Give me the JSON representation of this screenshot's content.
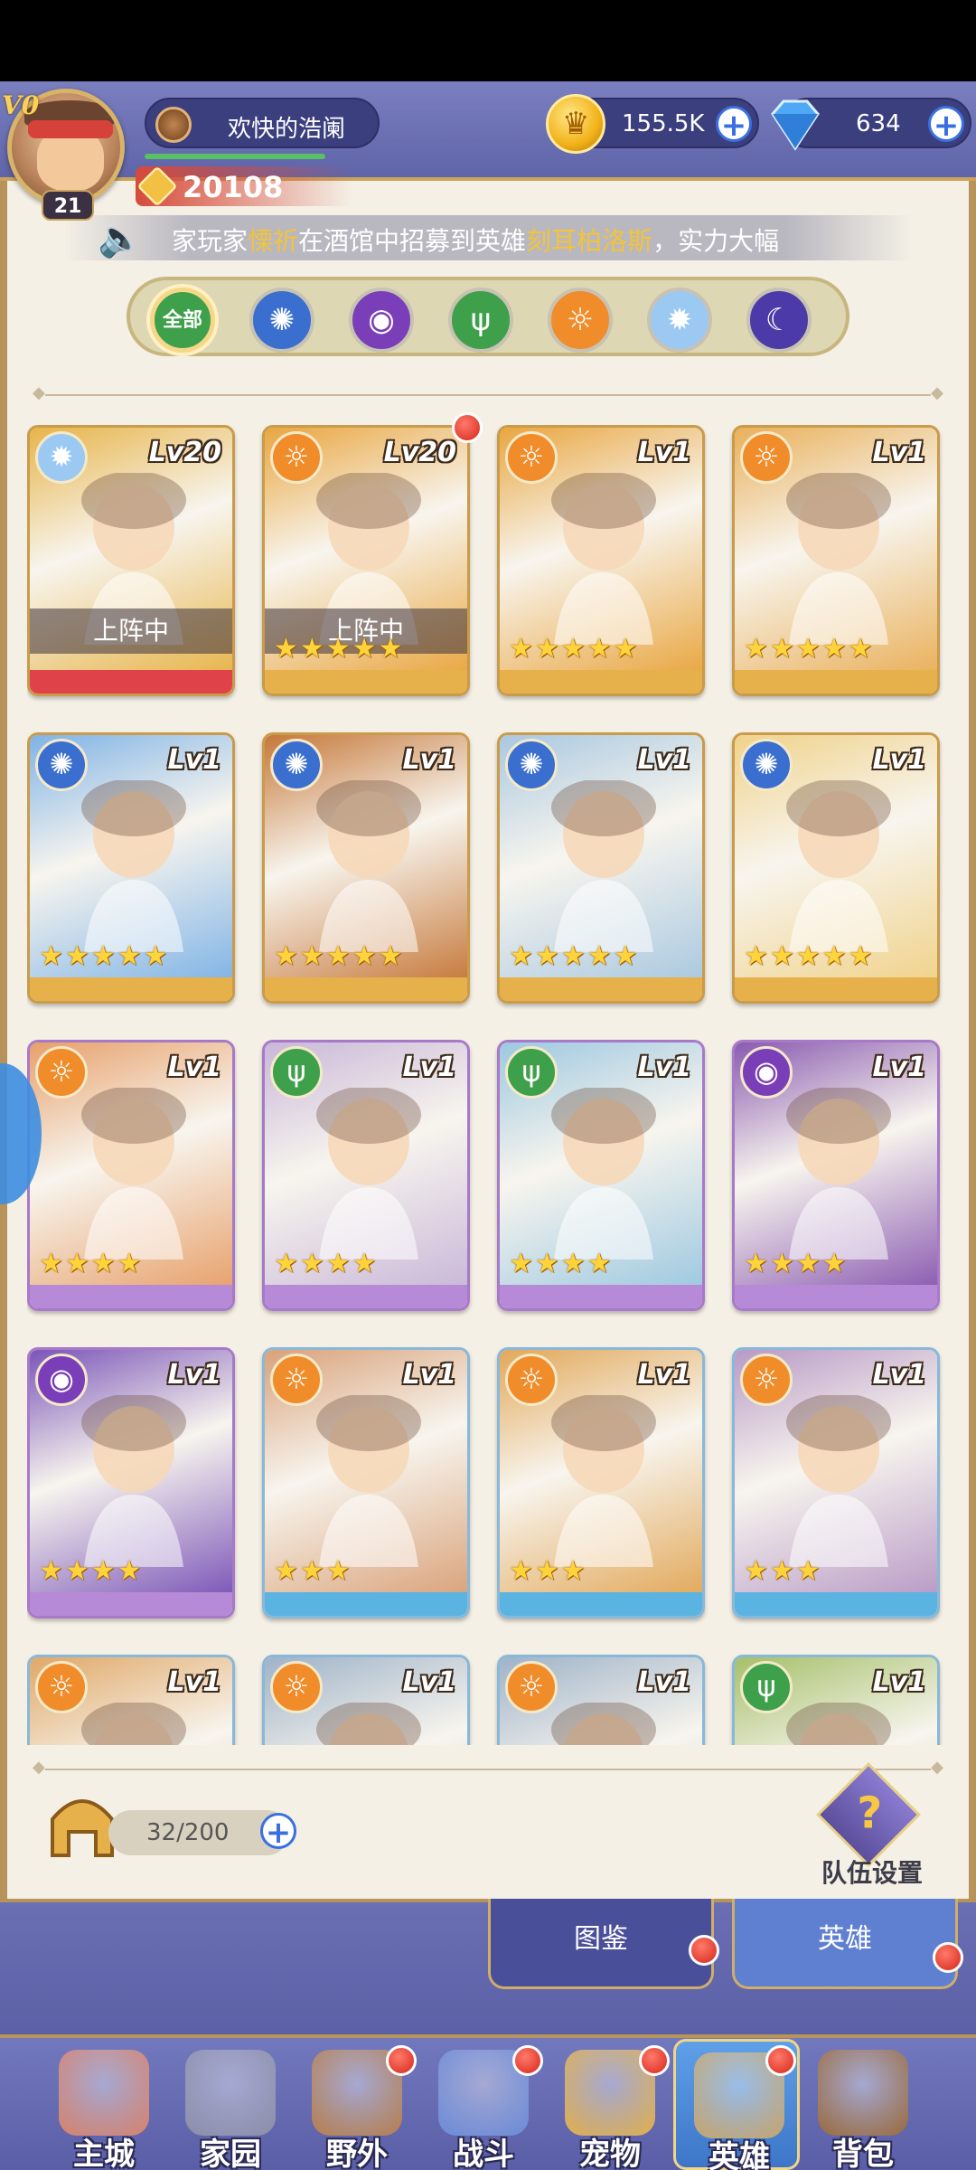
{
  "player": {
    "vip": "V0",
    "level": "21",
    "name": "欢快的浩阑",
    "power": "20108"
  },
  "currency": {
    "gold": "155.5K",
    "gems": "634",
    "plus": "+"
  },
  "marquee": {
    "prefix": "家玩家",
    "player": "慄祈",
    "middle": "在酒馆中招募到英雄",
    "hero": "刻耳柏洛斯",
    "suffix": "，实力大幅"
  },
  "filters": {
    "all_label": "全部",
    "items": [
      "all",
      "water",
      "dark-eye",
      "nature",
      "fire",
      "light",
      "moon"
    ]
  },
  "colors": {
    "fire": "#f08c2a",
    "water": "#3a6fd0",
    "nature": "#3ea04a",
    "dark": "#7a3fb8",
    "light": "#9bc9f2",
    "moon": "#4b3aa8"
  },
  "heroes": [
    {
      "level": "Lv20",
      "faction": "light",
      "stars": "",
      "deployed": "上阵中",
      "frame": "gold",
      "foot": "red",
      "bg": "#e7b44a",
      "red_dot": false
    },
    {
      "level": "Lv20",
      "faction": "fire",
      "stars": "★★★★★",
      "deployed": "上阵中",
      "frame": "gold",
      "foot": "gold",
      "bg": "#e9a640",
      "red_dot": true
    },
    {
      "level": "Lv1",
      "faction": "fire",
      "stars": "★★★★★",
      "deployed": "",
      "frame": "gold",
      "foot": "gold",
      "bg": "#e9a640",
      "red_dot": false
    },
    {
      "level": "Lv1",
      "faction": "fire",
      "stars": "★★★★★",
      "deployed": "",
      "frame": "gold",
      "foot": "gold",
      "bg": "#e9b05a",
      "red_dot": false
    },
    {
      "level": "Lv1",
      "faction": "water",
      "stars": "★★★★★",
      "deployed": "",
      "frame": "gold",
      "foot": "gold",
      "bg": "#7fb3e6",
      "red_dot": false
    },
    {
      "level": "Lv1",
      "faction": "water",
      "stars": "★★★★★",
      "deployed": "",
      "frame": "gold",
      "foot": "gold",
      "bg": "#c6783a",
      "red_dot": false
    },
    {
      "level": "Lv1",
      "faction": "water",
      "stars": "★★★★★",
      "deployed": "",
      "frame": "gold",
      "foot": "gold",
      "bg": "#a9c8e0",
      "red_dot": false
    },
    {
      "level": "Lv1",
      "faction": "water",
      "stars": "★★★★★",
      "deployed": "",
      "frame": "gold",
      "foot": "gold",
      "bg": "#f0d28a",
      "red_dot": false
    },
    {
      "level": "Lv1",
      "faction": "fire",
      "stars": "★★★★",
      "deployed": "",
      "frame": "purple",
      "foot": "purple",
      "bg": "#e7a06a",
      "red_dot": false
    },
    {
      "level": "Lv1",
      "faction": "nature",
      "stars": "★★★★",
      "deployed": "",
      "frame": "purple",
      "foot": "purple",
      "bg": "#c9b7d8",
      "red_dot": false
    },
    {
      "level": "Lv1",
      "faction": "nature",
      "stars": "★★★★",
      "deployed": "",
      "frame": "purple",
      "foot": "purple",
      "bg": "#9dc8e0",
      "red_dot": false
    },
    {
      "level": "Lv1",
      "faction": "dark",
      "stars": "★★★★",
      "deployed": "",
      "frame": "purple",
      "foot": "purple",
      "bg": "#8a5ab0",
      "red_dot": false
    },
    {
      "level": "Lv1",
      "faction": "dark",
      "stars": "★★★★",
      "deployed": "",
      "frame": "purple",
      "foot": "purple",
      "bg": "#7b55b8",
      "red_dot": false
    },
    {
      "level": "Lv1",
      "faction": "fire",
      "stars": "★★★",
      "deployed": "",
      "frame": "blue",
      "foot": "blue",
      "bg": "#d9a27a",
      "red_dot": false
    },
    {
      "level": "Lv1",
      "faction": "fire",
      "stars": "★★★",
      "deployed": "",
      "frame": "blue",
      "foot": "blue",
      "bg": "#e2a85a",
      "red_dot": false
    },
    {
      "level": "Lv1",
      "faction": "fire",
      "stars": "★★★",
      "deployed": "",
      "frame": "blue",
      "foot": "blue",
      "bg": "#b89ac6",
      "red_dot": false
    },
    {
      "level": "Lv1",
      "faction": "fire",
      "stars": "",
      "deployed": "",
      "frame": "blue",
      "foot": "blue",
      "bg": "#e0a868",
      "red_dot": false
    },
    {
      "level": "Lv1",
      "faction": "fire",
      "stars": "",
      "deployed": "",
      "frame": "blue",
      "foot": "blue",
      "bg": "#9fb3c8",
      "red_dot": false
    },
    {
      "level": "Lv1",
      "faction": "fire",
      "stars": "",
      "deployed": "",
      "frame": "blue",
      "foot": "blue",
      "bg": "#9fb3c8",
      "red_dot": false
    },
    {
      "level": "Lv1",
      "faction": "nature",
      "stars": "",
      "deployed": "",
      "frame": "blue",
      "foot": "blue",
      "bg": "#a6c06a",
      "red_dot": false
    }
  ],
  "capacity": "32/200",
  "team_settings": "队伍设置",
  "segments": {
    "codex": "图鉴",
    "heroes": "英雄"
  },
  "nav": [
    {
      "label": "主城",
      "color": "#d8826a",
      "red_dot": false
    },
    {
      "label": "家园",
      "color": "#8b8ea8",
      "red_dot": false
    },
    {
      "label": "野外",
      "color": "#b77e4a",
      "red_dot": true
    },
    {
      "label": "战斗",
      "color": "#6a8bd8",
      "red_dot": true
    },
    {
      "label": "宠物",
      "color": "#e2b04a",
      "red_dot": true
    },
    {
      "label": "英雄",
      "color": "#c8a56a",
      "red_dot": true
    },
    {
      "label": "背包",
      "color": "#9a6a3a",
      "red_dot": false
    }
  ]
}
